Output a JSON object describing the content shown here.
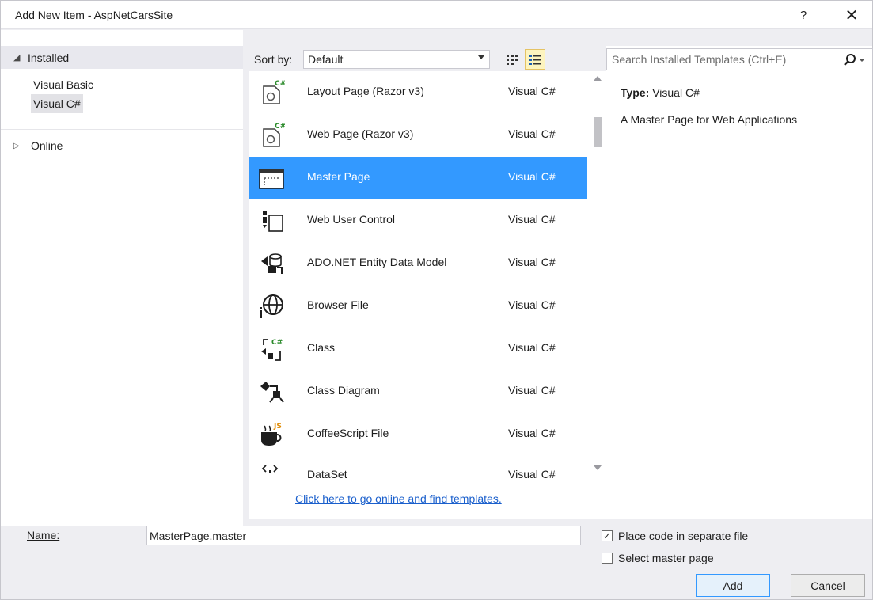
{
  "window": {
    "title": "Add New Item - AspNetCarsSite",
    "help_label": "?",
    "close_label": "✕"
  },
  "left": {
    "installed_label": "Installed",
    "installed_children": [
      "Visual Basic",
      "Visual C#"
    ],
    "selected_child": "Visual C#",
    "online_label": "Online"
  },
  "sort": {
    "label": "Sort by:",
    "value": "Default"
  },
  "templates": [
    {
      "name": "Layout Page (Razor v3)",
      "lang": "Visual C#",
      "icon": "razor-page-icon"
    },
    {
      "name": "Web Page (Razor v3)",
      "lang": "Visual C#",
      "icon": "razor-page-icon"
    },
    {
      "name": "Master Page",
      "lang": "Visual C#",
      "icon": "master-page-icon",
      "selected": true
    },
    {
      "name": "Web User Control",
      "lang": "Visual C#",
      "icon": "user-control-icon"
    },
    {
      "name": "ADO.NET Entity Data Model",
      "lang": "Visual C#",
      "icon": "entity-model-icon"
    },
    {
      "name": "Browser File",
      "lang": "Visual C#",
      "icon": "globe-icon"
    },
    {
      "name": "Class",
      "lang": "Visual C#",
      "icon": "class-icon"
    },
    {
      "name": "Class Diagram",
      "lang": "Visual C#",
      "icon": "class-diagram-icon"
    },
    {
      "name": "CoffeeScript File",
      "lang": "Visual C#",
      "icon": "coffee-cup-icon"
    },
    {
      "name": "DataSet",
      "lang": "Visual C#",
      "icon": "dataset-icon"
    }
  ],
  "online_link": "Click here to go online and find templates.",
  "search": {
    "placeholder": "Search Installed Templates (Ctrl+E)"
  },
  "details": {
    "type_label": "Type:",
    "type_value": "Visual C#",
    "description": "A Master Page for Web Applications"
  },
  "bottom": {
    "name_label": "Name:",
    "name_value": "MasterPage.master",
    "place_code_label": "Place code in separate file",
    "place_code_checked": true,
    "select_master_label": "Select master page",
    "select_master_checked": false,
    "add_label": "Add",
    "cancel_label": "Cancel"
  },
  "colors": {
    "selection": "#3399ff",
    "link": "#1a5fcc",
    "dialog_bg": "#eeeef2"
  }
}
